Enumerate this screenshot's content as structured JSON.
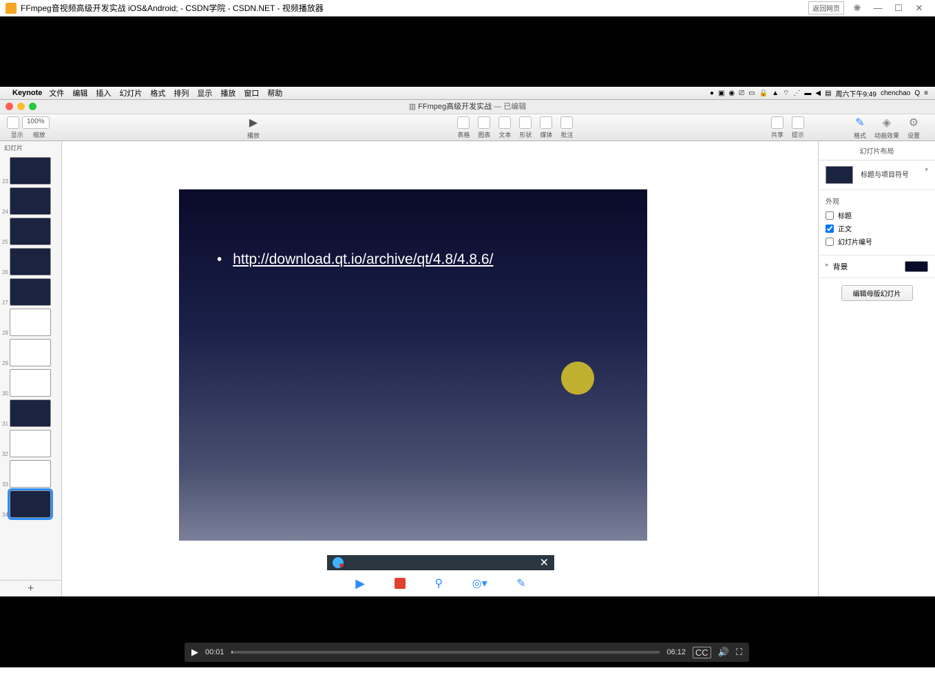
{
  "window": {
    "title": "FFmpeg音视频高级开发实战 iOS&Android; - CSDN学院 - CSDN.NET - 视频播放器",
    "back_home": "返回网页"
  },
  "mac_menubar": {
    "app": "Keynote",
    "menus": [
      "文件",
      "编辑",
      "插入",
      "幻灯片",
      "格式",
      "排列",
      "显示",
      "播放",
      "窗口",
      "帮助"
    ],
    "time": "周六下午9:49",
    "user": "chenchao"
  },
  "keynote": {
    "doc_title": "FFmpeg高级开发实战",
    "doc_state": "— 已编辑",
    "toolbar": {
      "view": "显示",
      "zoom_btn": "缩放",
      "zoom": "100%",
      "play": "播放",
      "center_labels": [
        "表格",
        "图表",
        "文本",
        "形状",
        "媒体",
        "批注"
      ],
      "share": "共享",
      "hint": "提示",
      "format": "格式",
      "animate": "动画效果",
      "settings": "设置"
    },
    "thumbs_header": "幻灯片",
    "thumb_start": 23,
    "thumb_count": 12,
    "selected_thumb": 34,
    "light_thumbs": [
      28,
      29,
      30,
      32,
      33
    ],
    "slide": {
      "bullet_text": "http://download.qt.io/archive/qt/4.8/4.8.6/"
    },
    "inspector": {
      "header": "幻灯片布局",
      "layout_name": "标题与项目符号",
      "appearance": "外观",
      "cb_title": "标题",
      "cb_body": "正文",
      "cb_number": "幻灯片编号",
      "cb_title_checked": false,
      "cb_body_checked": true,
      "cb_number_checked": false,
      "background": "背景",
      "master_btn": "编辑母版幻灯片"
    }
  },
  "player": {
    "current": "00:01",
    "total": "06:12",
    "cc": "CC"
  }
}
